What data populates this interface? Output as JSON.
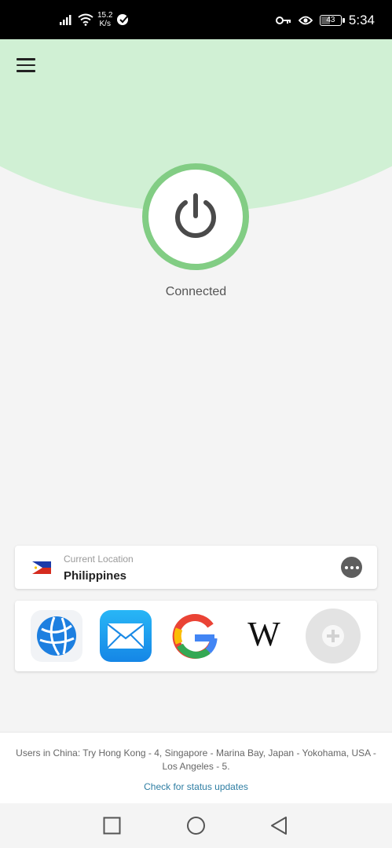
{
  "status_bar": {
    "speed_value": "15.2",
    "speed_unit": "K/s",
    "battery": "43",
    "battery_level": 0.43,
    "time": "5:34"
  },
  "colors": {
    "accent_green": "#82cd84",
    "arc_green": "#d0f0d4",
    "link_blue": "#2f7ea3"
  },
  "header": {
    "menu_icon": "hamburger-menu-icon"
  },
  "connection": {
    "status": "Connected",
    "icon": "power-icon"
  },
  "location": {
    "label": "Current Location",
    "country": "Philippines",
    "flag": "philippines-flag",
    "more_icon": "more-options-icon"
  },
  "shortcuts": [
    {
      "name": "Browser",
      "icon": "globe-icon"
    },
    {
      "name": "Mail",
      "icon": "mail-icon"
    },
    {
      "name": "Google",
      "icon": "google-icon"
    },
    {
      "name": "Wikipedia",
      "icon": "wikipedia-icon"
    },
    {
      "name": "Add shortcut",
      "icon": "add-icon"
    }
  ],
  "footer": {
    "notice": "Users in China: Try Hong Kong - 4, Singapore - Marina Bay, Japan - Yokohama, USA - Los Angeles - 5.",
    "link": "Check for status updates"
  },
  "nav_bar": {
    "recents_icon": "square-recents-icon",
    "home_icon": "circle-home-icon",
    "back_icon": "triangle-back-icon"
  }
}
